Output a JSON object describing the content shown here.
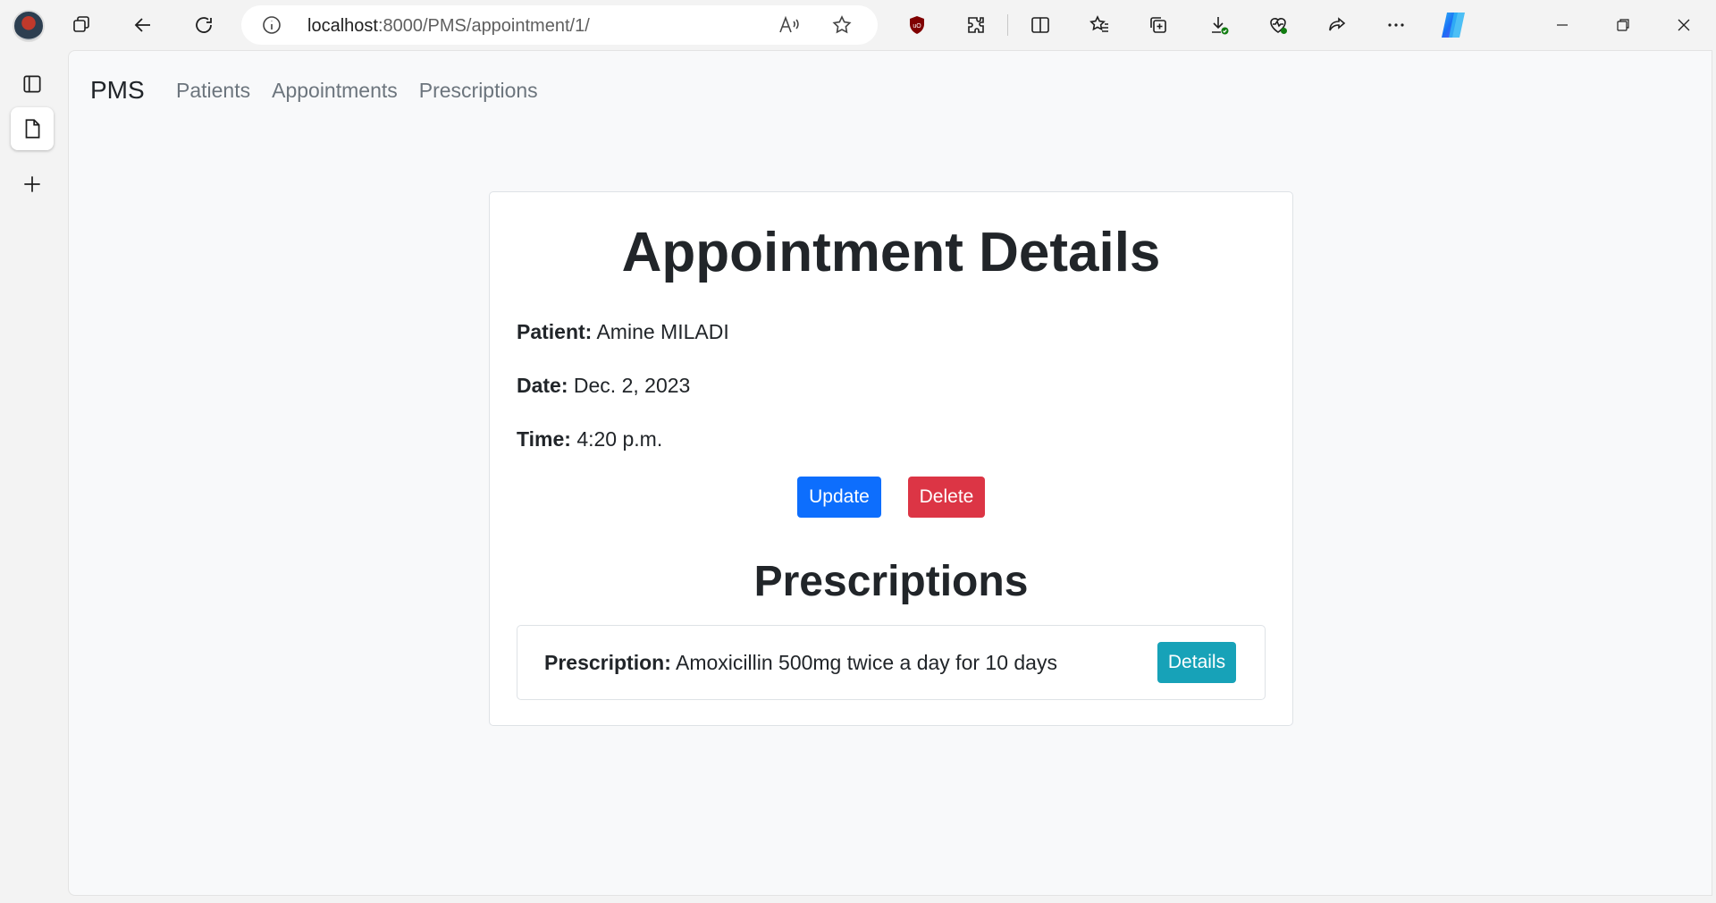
{
  "browser": {
    "url_host": "localhost",
    "url_path": ":8000/PMS/appointment/1/"
  },
  "navbar": {
    "brand": "PMS",
    "links": [
      "Patients",
      "Appointments",
      "Prescriptions"
    ]
  },
  "appointment": {
    "title": "Appointment Details",
    "patient_label": "Patient:",
    "patient_value": "Amine MILADI",
    "date_label": "Date:",
    "date_value": "Dec. 2, 2023",
    "time_label": "Time:",
    "time_value": "4:20 p.m.",
    "update_label": "Update",
    "delete_label": "Delete"
  },
  "prescriptions": {
    "heading": "Prescriptions",
    "items": [
      {
        "label": "Prescription:",
        "value": "Amoxicillin 500mg twice a day for 10 days",
        "details_label": "Details"
      }
    ]
  },
  "colors": {
    "primary": "#0d6efd",
    "danger": "#dc3545",
    "info": "#17a2b8"
  }
}
